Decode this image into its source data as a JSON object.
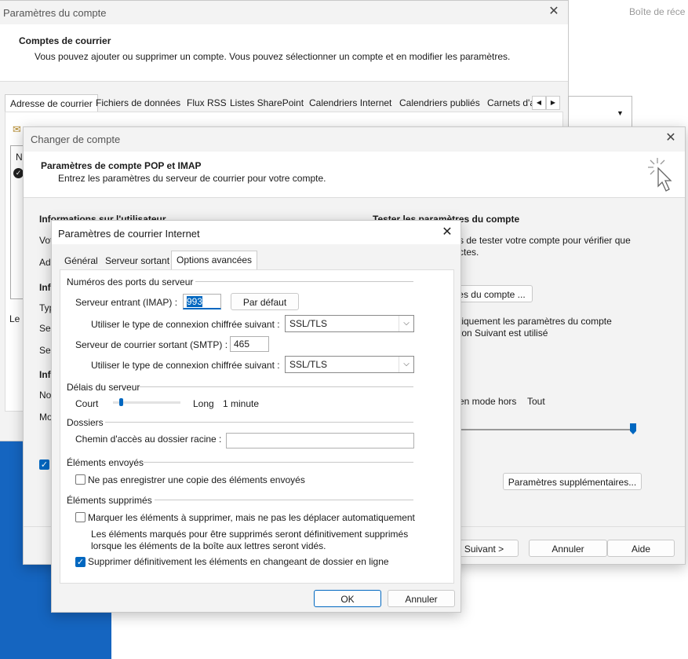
{
  "background": {
    "right_title": "Boîte de réce"
  },
  "account_settings": {
    "title": "Paramètres du compte",
    "header_title": "Comptes de courrier",
    "header_sub": "Vous pouvez ajouter ou supprimer un compte. Vous pouvez sélectionner un compte et en modifier les paramètres.",
    "tabs": [
      "Adresse de courrier",
      "Fichiers de données",
      "Flux RSS",
      "Listes SharePoint",
      "Calendriers Internet",
      "Calendriers publiés",
      "Carnets d'a"
    ],
    "list_col": "N",
    "side_left": "Le c"
  },
  "change_account": {
    "title": "Changer de compte",
    "header_title": "Paramètres de compte POP et IMAP",
    "header_sub": "Entrez les paramètres du serveur de courrier pour votre compte.",
    "user_info": "Informations sur l'utilisateur",
    "left_labels": [
      "Vot",
      "Adr",
      "Inf",
      "Typ",
      "Ser",
      "Ser",
      "Inf",
      "No",
      "Mo"
    ],
    "test_title": "Tester les paramètres du compte",
    "test_sub1": "s de tester votre compte pour vérifier que",
    "test_sub2": "ctes.",
    "test_button": "es du compte ...",
    "auto_line1": "tiquement les paramètres du compte",
    "auto_line2": "ton Suivant est utilisé",
    "offline": "en mode hors",
    "all": "Tout",
    "more_settings": "Paramètres supplémentaires...",
    "next": "Suivant >",
    "cancel": "Annuler",
    "help": "Aide"
  },
  "internet_settings": {
    "title": "Paramètres de courrier Internet",
    "tabs": [
      "Général",
      "Serveur sortant",
      "Options avancées"
    ],
    "ports_group": "Numéros des ports du serveur",
    "incoming_label": "Serveur entrant (IMAP) :",
    "incoming_value": "993",
    "default_button": "Par défaut",
    "encryption_label_1": "Utiliser le type de connexion chiffrée suivant :",
    "encryption_value_1": "SSL/TLS",
    "outgoing_label": "Serveur de courrier sortant (SMTP) :",
    "outgoing_value": "465",
    "encryption_label_2": "Utiliser le type de connexion chiffrée suivant :",
    "encryption_value_2": "SSL/TLS",
    "timeout_group": "Délais du serveur",
    "short": "Court",
    "long": "Long",
    "timeout_value": "1 minute",
    "timeout_level": 0.1,
    "folders_group": "Dossiers",
    "root_path_label": "Chemin d'accès au dossier racine :",
    "root_path_value": "",
    "sent_group": "Éléments envoyés",
    "sent_checkbox": "Ne pas enregistrer une copie des éléments envoyés",
    "deleted_group": "Éléments supprimés",
    "mark_checkbox": "Marquer les éléments à supprimer, mais ne pas les déplacer automatiquement",
    "mark_note1": "Les éléments marqués pour être supprimés seront définitivement supprimés",
    "mark_note2": "lorsque les éléments de la boîte aux lettres seront vidés.",
    "purge_checkbox": "Supprimer définitivement les éléments en changeant de dossier en ligne",
    "ok": "OK",
    "cancel": "Annuler"
  },
  "colors": {
    "accent": "#0067c0",
    "desktop_blue": "#1565c0"
  }
}
